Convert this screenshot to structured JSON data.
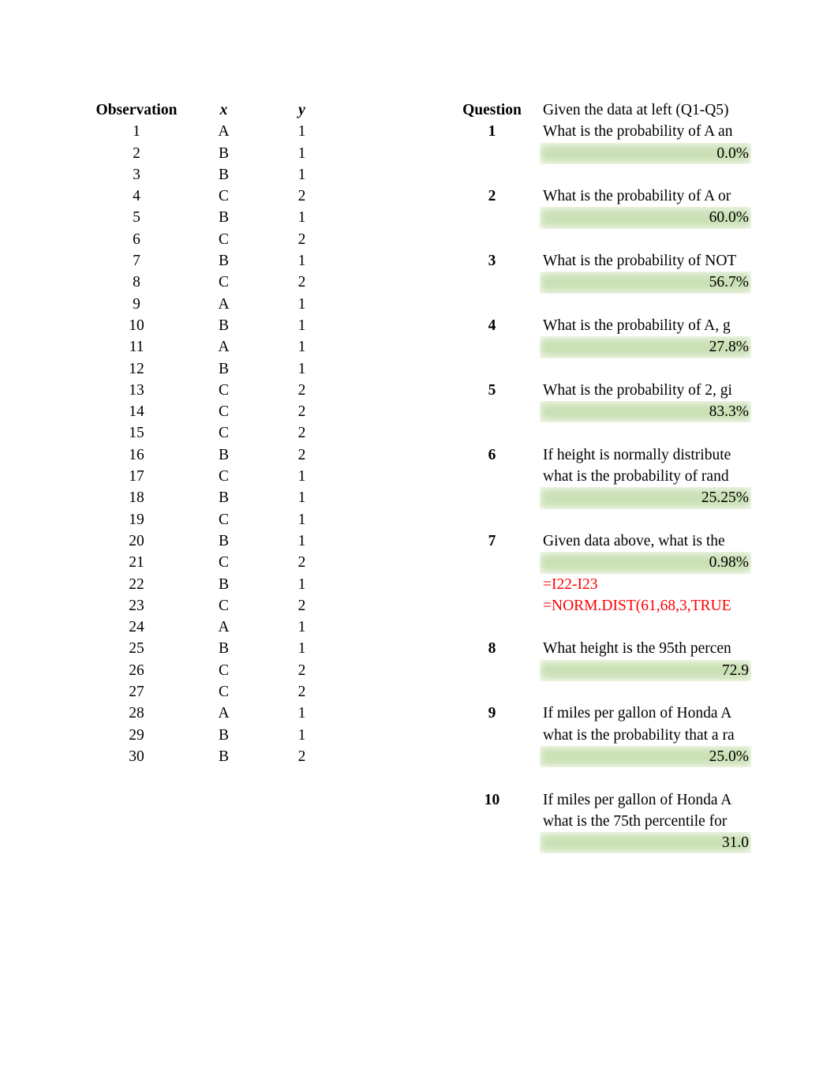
{
  "data_table": {
    "headers": [
      "Observation",
      "x",
      "y"
    ],
    "rows": [
      [
        "1",
        "A",
        "1"
      ],
      [
        "2",
        "B",
        "1"
      ],
      [
        "3",
        "B",
        "1"
      ],
      [
        "4",
        "C",
        "2"
      ],
      [
        "5",
        "B",
        "1"
      ],
      [
        "6",
        "C",
        "2"
      ],
      [
        "7",
        "B",
        "1"
      ],
      [
        "8",
        "C",
        "2"
      ],
      [
        "9",
        "A",
        "1"
      ],
      [
        "10",
        "B",
        "1"
      ],
      [
        "11",
        "A",
        "1"
      ],
      [
        "12",
        "B",
        "1"
      ],
      [
        "13",
        "C",
        "2"
      ],
      [
        "14",
        "C",
        "2"
      ],
      [
        "15",
        "C",
        "2"
      ],
      [
        "16",
        "B",
        "2"
      ],
      [
        "17",
        "C",
        "1"
      ],
      [
        "18",
        "B",
        "1"
      ],
      [
        "19",
        "C",
        "1"
      ],
      [
        "20",
        "B",
        "1"
      ],
      [
        "21",
        "C",
        "2"
      ],
      [
        "22",
        "B",
        "1"
      ],
      [
        "23",
        "C",
        "2"
      ],
      [
        "24",
        "A",
        "1"
      ],
      [
        "25",
        "B",
        "1"
      ],
      [
        "26",
        "C",
        "2"
      ],
      [
        "27",
        "C",
        "2"
      ],
      [
        "28",
        "A",
        "1"
      ],
      [
        "29",
        "B",
        "1"
      ],
      [
        "30",
        "B",
        "2"
      ]
    ]
  },
  "questions": {
    "header_label": "Question",
    "header_text": "Given the data at left (Q1-Q5)",
    "items": [
      {
        "number": "1",
        "lines": [
          "What is the probability of A an"
        ],
        "answer": "0.0%",
        "formulas": []
      },
      {
        "number": "2",
        "lines": [
          "What is the probability of A or"
        ],
        "answer": "60.0%",
        "formulas": []
      },
      {
        "number": "3",
        "lines": [
          "What is the probability of NOT"
        ],
        "answer": "56.7%",
        "formulas": []
      },
      {
        "number": "4",
        "lines": [
          "What is the probability of A, g"
        ],
        "answer": "27.8%",
        "formulas": []
      },
      {
        "number": "5",
        "lines": [
          "What is the probability of 2, gi"
        ],
        "answer": "83.3%",
        "formulas": []
      },
      {
        "number": "6",
        "lines": [
          "If height is normally distribute",
          "what is the probability of rand"
        ],
        "answer": "25.25%",
        "formulas": []
      },
      {
        "number": "7",
        "lines": [
          "Given data above, what is the"
        ],
        "answer": "0.98%",
        "formulas": [
          "=I22-I23",
          "=NORM.DIST(61,68,3,TRUE"
        ]
      },
      {
        "number": "8",
        "lines": [
          "What height is the 95th percen"
        ],
        "answer": "72.9",
        "formulas": []
      },
      {
        "number": "9",
        "lines": [
          "If miles per gallon of Honda A",
          "what is the probability that a ra"
        ],
        "answer": "25.0%",
        "formulas": []
      },
      {
        "number": "10",
        "lines": [
          "If miles per gallon of Honda A",
          "what is the 75th percentile for"
        ],
        "answer": "31.0",
        "formulas": []
      }
    ]
  },
  "colors": {
    "highlight_green": "#c8dfb2",
    "formula_red": "#ff0000",
    "text_black": "#000000",
    "page_background": "#ffffff"
  }
}
